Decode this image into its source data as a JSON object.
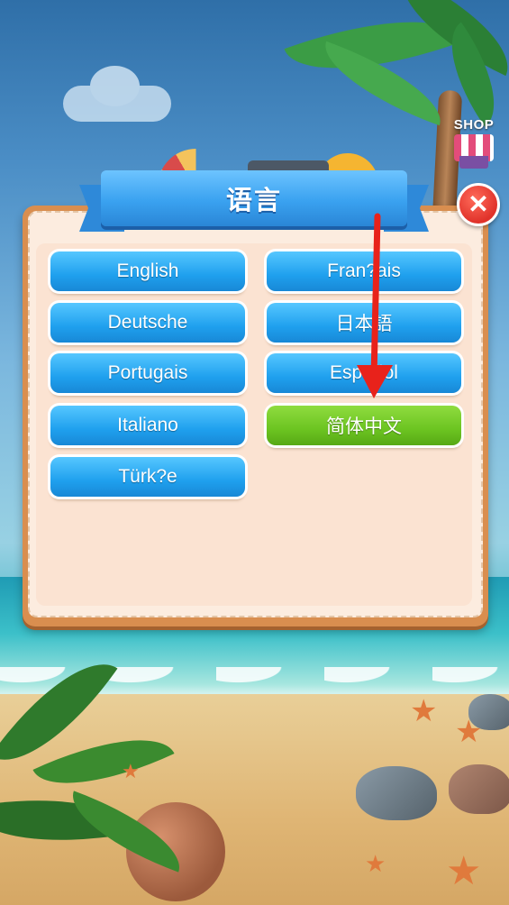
{
  "shop": {
    "label": "SHOP"
  },
  "dialog": {
    "title": "语言",
    "close_symbol": "✕",
    "languages": [
      {
        "label": "English",
        "selected": false
      },
      {
        "label": "Fran?ais",
        "selected": false
      },
      {
        "label": "Deutsche",
        "selected": false
      },
      {
        "label": "日本語",
        "selected": false
      },
      {
        "label": "Portugais",
        "selected": false
      },
      {
        "label": "Español",
        "selected": false
      },
      {
        "label": "Italiano",
        "selected": false
      },
      {
        "label": "简体中文",
        "selected": true
      },
      {
        "label": "Türk?e",
        "selected": false
      }
    ]
  },
  "colors": {
    "button_blue": "#1fa0ee",
    "button_selected_green": "#6cc421",
    "dialog_frame": "#d98e4f",
    "close_red": "#e0322a",
    "annotation_arrow": "#e8221b"
  }
}
